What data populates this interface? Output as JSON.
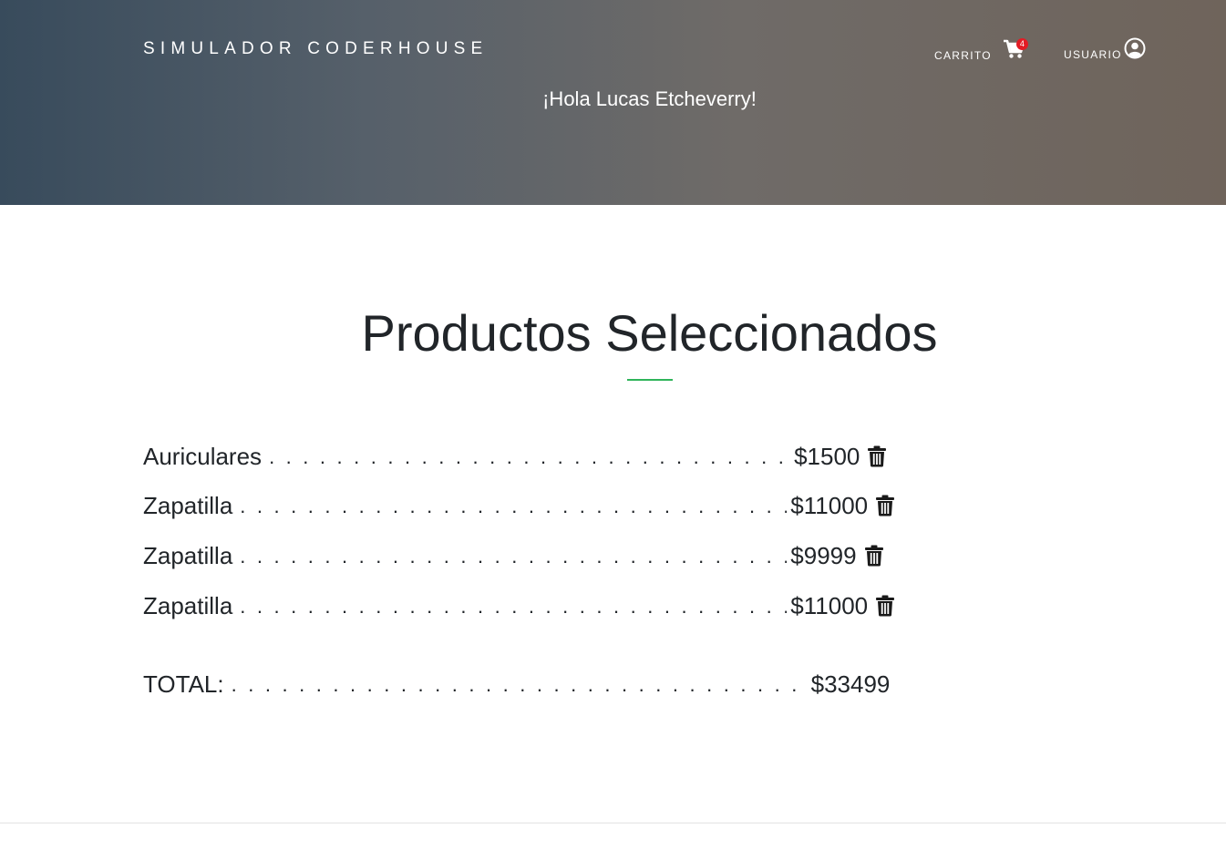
{
  "header": {
    "brand": "SIMULADOR CODERHOUSE",
    "cart_label": "CARRITO",
    "cart_count": "4",
    "user_label": "USUARIO",
    "greeting": "¡Hola Lucas Etcheverry!"
  },
  "main": {
    "title": "Productos Seleccionados",
    "items": [
      {
        "name": "Auriculares",
        "price": "$1500"
      },
      {
        "name": "Zapatilla",
        "price": "$11000"
      },
      {
        "name": "Zapatilla",
        "price": "$9999"
      },
      {
        "name": "Zapatilla",
        "price": "$11000"
      }
    ],
    "total_label": "TOTAL:",
    "total_value": "$33499"
  },
  "colors": {
    "accent": "#2fb45a",
    "badge": "#e31c25",
    "hero_start": "#384b5c",
    "hero_end": "#6f645b"
  },
  "icons": {
    "cart": "cart-icon",
    "user": "user-circle-icon",
    "delete": "trash-icon"
  }
}
